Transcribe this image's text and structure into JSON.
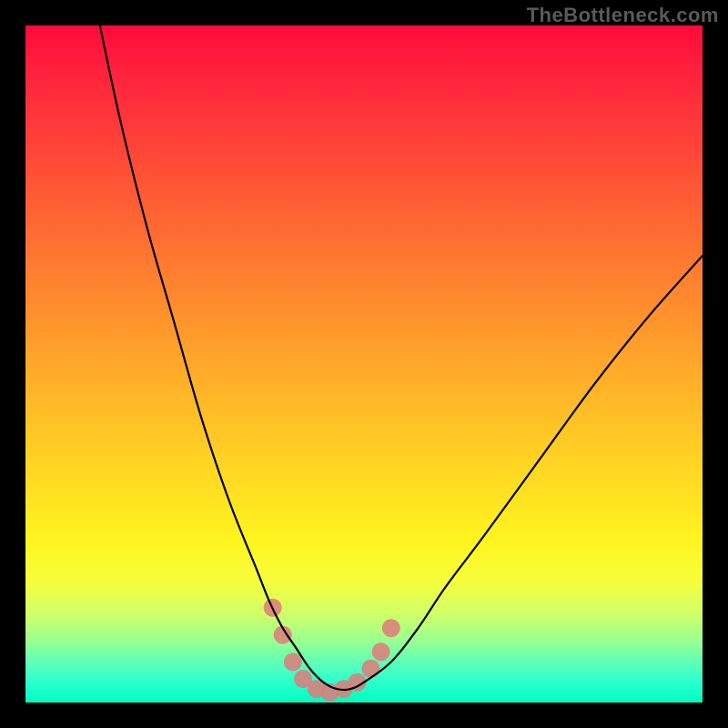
{
  "watermark": "TheBottleneck.com",
  "chart_data": {
    "type": "line",
    "title": "",
    "xlabel": "",
    "ylabel": "",
    "xlim": [
      0,
      100
    ],
    "ylim": [
      0,
      100
    ],
    "series": [
      {
        "name": "bottleneck-curve",
        "color": "#000000",
        "x": [
          11,
          14,
          18,
          22,
          26,
          30,
          34,
          36,
          38,
          40,
          42,
          44,
          46,
          48,
          50,
          54,
          58,
          62,
          68,
          76,
          84,
          92,
          100
        ],
        "y": [
          100,
          86,
          70,
          56,
          42,
          30,
          20,
          15,
          11,
          8,
          5,
          3,
          2,
          2,
          3,
          6,
          11,
          17,
          25,
          36,
          47,
          57,
          66
        ]
      }
    ],
    "markers": {
      "name": "highlight-dots",
      "color": "#e07a7a",
      "points": [
        {
          "x": 36.5,
          "y": 14
        },
        {
          "x": 38,
          "y": 10
        },
        {
          "x": 39.5,
          "y": 6
        },
        {
          "x": 41,
          "y": 3.5
        },
        {
          "x": 43,
          "y": 2
        },
        {
          "x": 45,
          "y": 1.5
        },
        {
          "x": 47,
          "y": 2
        },
        {
          "x": 49,
          "y": 3
        },
        {
          "x": 51,
          "y": 5
        },
        {
          "x": 52.5,
          "y": 7.5
        },
        {
          "x": 54,
          "y": 11
        }
      ]
    },
    "gradient_stops": [
      {
        "pos": 0,
        "color": "#ff0a3a"
      },
      {
        "pos": 6,
        "color": "#ff1f3d"
      },
      {
        "pos": 18,
        "color": "#ff4438"
      },
      {
        "pos": 30,
        "color": "#ff6a32"
      },
      {
        "pos": 42,
        "color": "#ff8f2d"
      },
      {
        "pos": 54,
        "color": "#ffb427"
      },
      {
        "pos": 66,
        "color": "#ffd822"
      },
      {
        "pos": 76,
        "color": "#fff41f"
      },
      {
        "pos": 82,
        "color": "#f6ff3a"
      },
      {
        "pos": 87,
        "color": "#cfff69"
      },
      {
        "pos": 91,
        "color": "#98ff92"
      },
      {
        "pos": 94,
        "color": "#5fffb5"
      },
      {
        "pos": 97,
        "color": "#2affce"
      },
      {
        "pos": 100,
        "color": "#00ffbf"
      }
    ]
  }
}
